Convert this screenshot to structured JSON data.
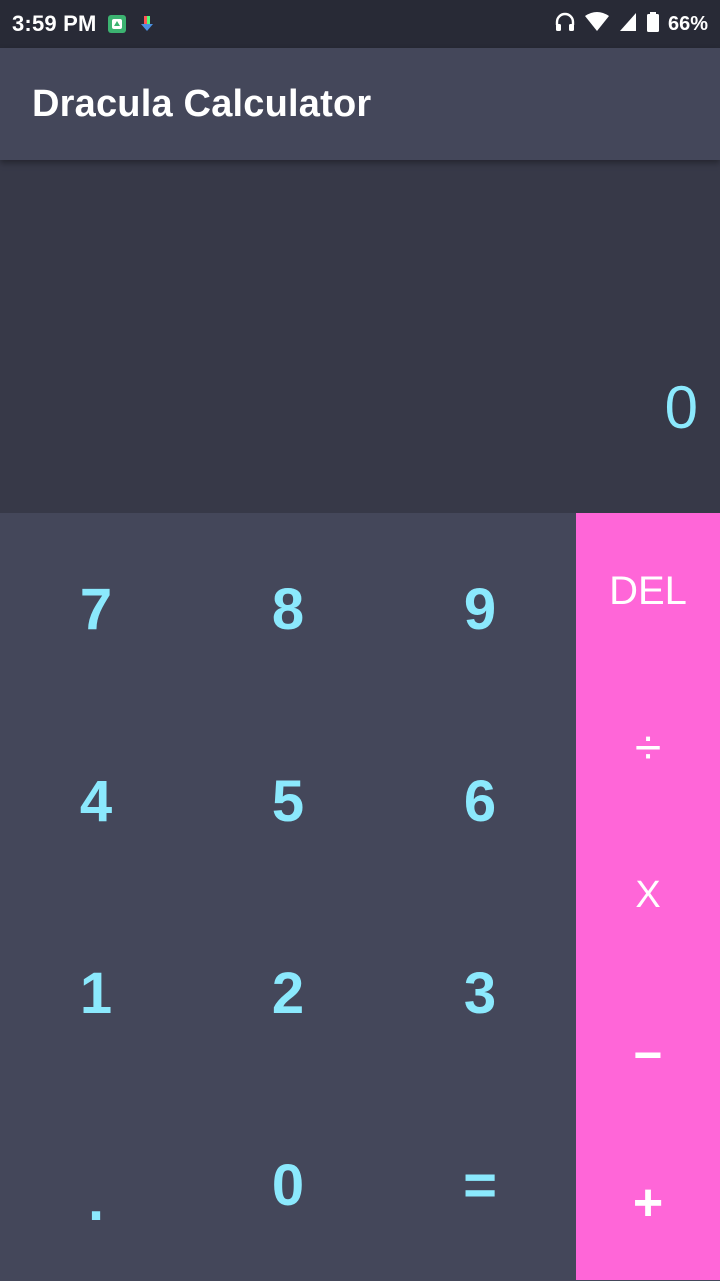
{
  "status_bar": {
    "time": "3:59 PM",
    "battery": "66%",
    "icons": [
      "app-notification-icon",
      "download-notification-icon",
      "headphones-icon",
      "wifi-icon",
      "signal-icon",
      "battery-icon"
    ]
  },
  "app_bar": {
    "title": "Dracula Calculator"
  },
  "display": {
    "value": "0"
  },
  "keypad": {
    "rows": [
      [
        "7",
        "8",
        "9"
      ],
      [
        "4",
        "5",
        "6"
      ],
      [
        "1",
        "2",
        "3"
      ],
      [
        ".",
        "0",
        "="
      ]
    ]
  },
  "operators": [
    "DEL",
    "÷",
    "X",
    "−",
    "+"
  ],
  "colors": {
    "status_bar": "#282a36",
    "app_bar": "#44475a",
    "display_bg": "#373948",
    "keypad_bg": "#44475a",
    "digit_text": "#8be9fd",
    "operator_bg": "#ff66d8",
    "operator_text": "#ffffff"
  }
}
